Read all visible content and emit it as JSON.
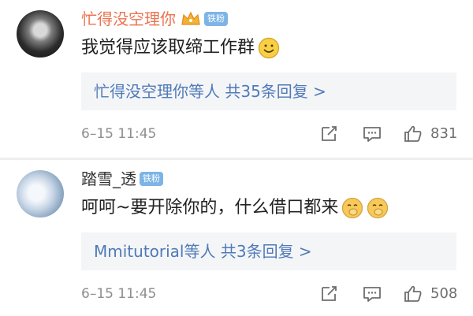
{
  "comments": [
    {
      "user": "忙得没空理你",
      "badge": "铁粉",
      "text": "我觉得应该取缔工作群",
      "reply_summary": "忙得没空理你等人  共35条回复 >",
      "date": "6–15 11:45",
      "like_count": "831"
    },
    {
      "user": "踏雪_透",
      "badge": "铁粉",
      "text": "呵呵~要开除你的，什么借口都来",
      "reply_summary": "Mmitutorial等人  共3条回复 >",
      "date": "6–15 11:45",
      "like_count": "508"
    }
  ],
  "colors": {
    "name_vip": "#eb7350",
    "name_normal": "#333333",
    "link": "#4f7ab8",
    "reply_bg": "#f4f5f7",
    "meta": "#8e8e8e",
    "badge": "#7db4e6"
  },
  "icons": [
    "crown-icon",
    "share-icon",
    "comment-icon",
    "like-icon",
    "smile-emoji",
    "shush-emoji"
  ]
}
